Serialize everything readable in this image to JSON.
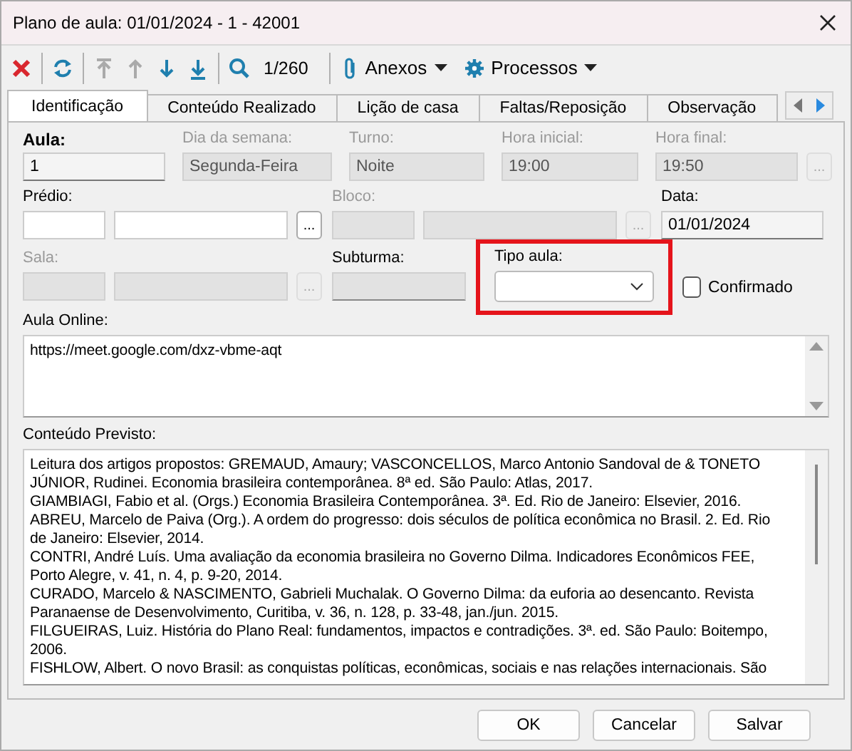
{
  "window": {
    "title": "Plano de aula: 01/01/2024 - 1 - 42001"
  },
  "toolbar": {
    "buttons": [
      {
        "kind": "delete",
        "disabled": false
      },
      {
        "kind": "refresh",
        "disabled": false
      },
      {
        "kind": "first",
        "disabled": true
      },
      {
        "kind": "previous",
        "disabled": true
      },
      {
        "kind": "next",
        "disabled": false
      },
      {
        "kind": "last",
        "disabled": false
      },
      {
        "kind": "search",
        "disabled": false
      }
    ],
    "record_counter": "1/260",
    "menus": [
      {
        "kind": "attach",
        "label": "Anexos"
      },
      {
        "kind": "gear",
        "label": "Processos"
      }
    ]
  },
  "tabs": [
    {
      "label": "Identificação",
      "selected": true
    },
    {
      "label": "Conteúdo Realizado",
      "selected": false
    },
    {
      "label": "Lição de casa",
      "selected": false
    },
    {
      "label": "Faltas/Reposição",
      "selected": false
    },
    {
      "label": "Observação",
      "selected": false
    }
  ],
  "row_1": [
    {
      "label": "Aula:",
      "value": "1",
      "disabled": false,
      "bold": true
    },
    {
      "label": "Dia da semana:",
      "value": "Segunda-Feira",
      "disabled": true,
      "bold": false
    },
    {
      "label": "Turno:",
      "value": "Noite",
      "disabled": true,
      "bold": false
    },
    {
      "label": "Hora inicial:",
      "value": "19:00",
      "disabled": true,
      "bold": false
    },
    {
      "label": "Hora final:",
      "value": "19:50",
      "disabled": true,
      "bold": false,
      "browse": "..."
    }
  ],
  "predio": {
    "label": "Prédio:",
    "disabled": false,
    "browse": "..."
  },
  "bloco": {
    "label": "Bloco:",
    "disabled": true,
    "browse": "..."
  },
  "data": {
    "label": "Data:",
    "value": "01/01/2024"
  },
  "sala": {
    "label": "Sala:",
    "disabled": true,
    "browse": "..."
  },
  "subturma": {
    "label": "Subturma:"
  },
  "tipo_aula": {
    "label": "Tipo aula:",
    "highlighted": true
  },
  "confirmado": {
    "label": "Confirmado",
    "checked": false
  },
  "aula_online": {
    "label": "Aula Online:",
    "value": "https://meet.google.com/dxz-vbme-aqt"
  },
  "conteudo_previsto": {
    "label": "Conteúdo Previsto:",
    "lines": [
      "Leitura dos artigos propostos: GREMAUD, Amaury; VASCONCELLOS, Marco Antonio Sandoval de & TONETO",
      "JÚNIOR, Rudinei. Economia brasileira contemporânea. 8ª ed. São Paulo: Atlas, 2017.",
      "GIAMBIAGI, Fabio et al. (Orgs.) Economia Brasileira Contemporânea. 3ª. Ed. Rio de Janeiro: Elsevier, 2016.",
      "ABREU, Marcelo de Paiva (Org.). A ordem do progresso: dois séculos de política econômica no Brasil. 2. Ed. Rio",
      "de Janeiro: Elsevier, 2014.",
      "CONTRI, André Luís. Uma avaliação da economia brasileira no Governo Dilma. Indicadores Econômicos FEE,",
      "Porto Alegre, v. 41, n. 4, p. 9-20, 2014.",
      "CURADO, Marcelo & NASCIMENTO, Gabrieli Muchalak. O Governo Dilma: da euforia ao desencanto. Revista",
      "Paranaense de Desenvolvimento, Curitiba, v. 36, n. 128, p. 33-48, jan./jun. 2015.",
      "FILGUEIRAS, Luiz. História do Plano Real: fundamentos, impactos e contradições. 3ª. ed. São Paulo: Boitempo,",
      "2006.",
      "FISHLOW, Albert. O novo Brasil: as conquistas políticas, econômicas, sociais e nas relações internacionais. São"
    ]
  },
  "buttons": [
    {
      "label": "OK"
    },
    {
      "label": "Cancelar"
    },
    {
      "label": "Salvar"
    }
  ]
}
